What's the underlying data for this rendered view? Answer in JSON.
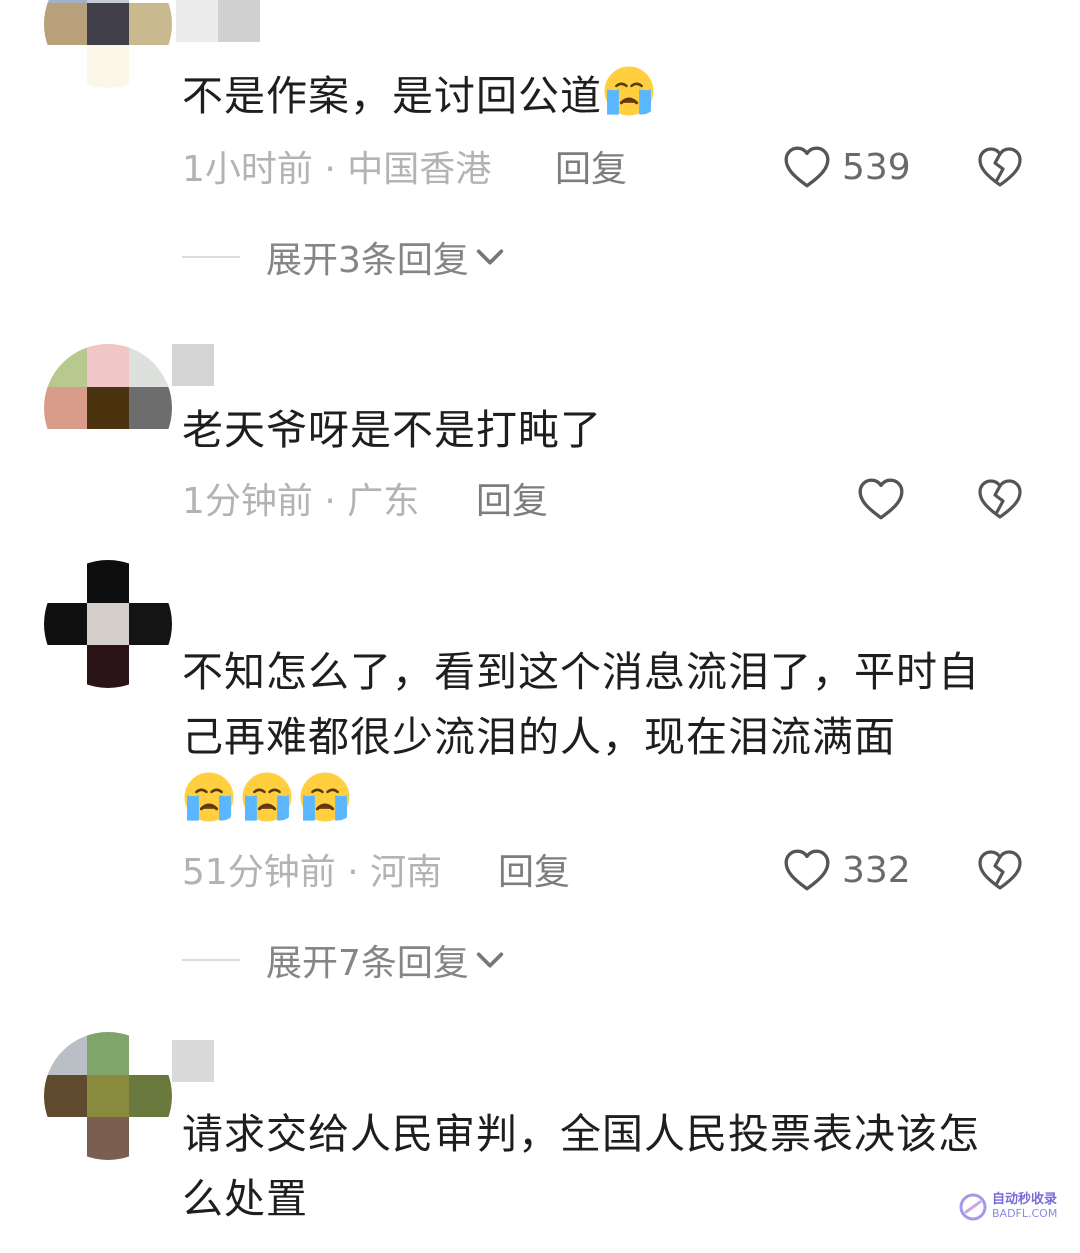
{
  "comments": [
    {
      "text": "不是作案，是讨回公道",
      "emoji_count": 1,
      "time_location": "1小时前 · 中国香港",
      "reply_label": "回复",
      "like_count": "539",
      "expand_label": "展开3条回复"
    },
    {
      "text": "老天爷呀是不是打盹了",
      "emoji_count": 0,
      "time_location": "1分钟前 · 广东",
      "reply_label": "回复",
      "like_count": "",
      "expand_label": ""
    },
    {
      "text": "不知怎么了，看到这个消息流泪了，平时自己再难都很少流泪的人，现在泪流满面",
      "emoji_count": 3,
      "time_location": "51分钟前 · 河南",
      "reply_label": "回复",
      "like_count": "332",
      "expand_label": "展开7条回复"
    },
    {
      "text": "请求交给人民审判，全国人民投票表决该怎么处置",
      "emoji_count": 0,
      "time_location": "",
      "reply_label": "",
      "like_count": "",
      "expand_label": ""
    }
  ],
  "icons": {
    "like": "heart-outline-icon",
    "dislike": "broken-heart-icon",
    "expand": "chevron-down-icon",
    "emoji": "loudly-crying-face-emoji"
  },
  "watermark": {
    "line1": "自动秒收录",
    "line2": "BADFL.COM"
  },
  "colors": {
    "text": "#1e1e1e",
    "meta": "#b3b3b3",
    "action": "#7d7d7d",
    "icon": "#555555"
  }
}
